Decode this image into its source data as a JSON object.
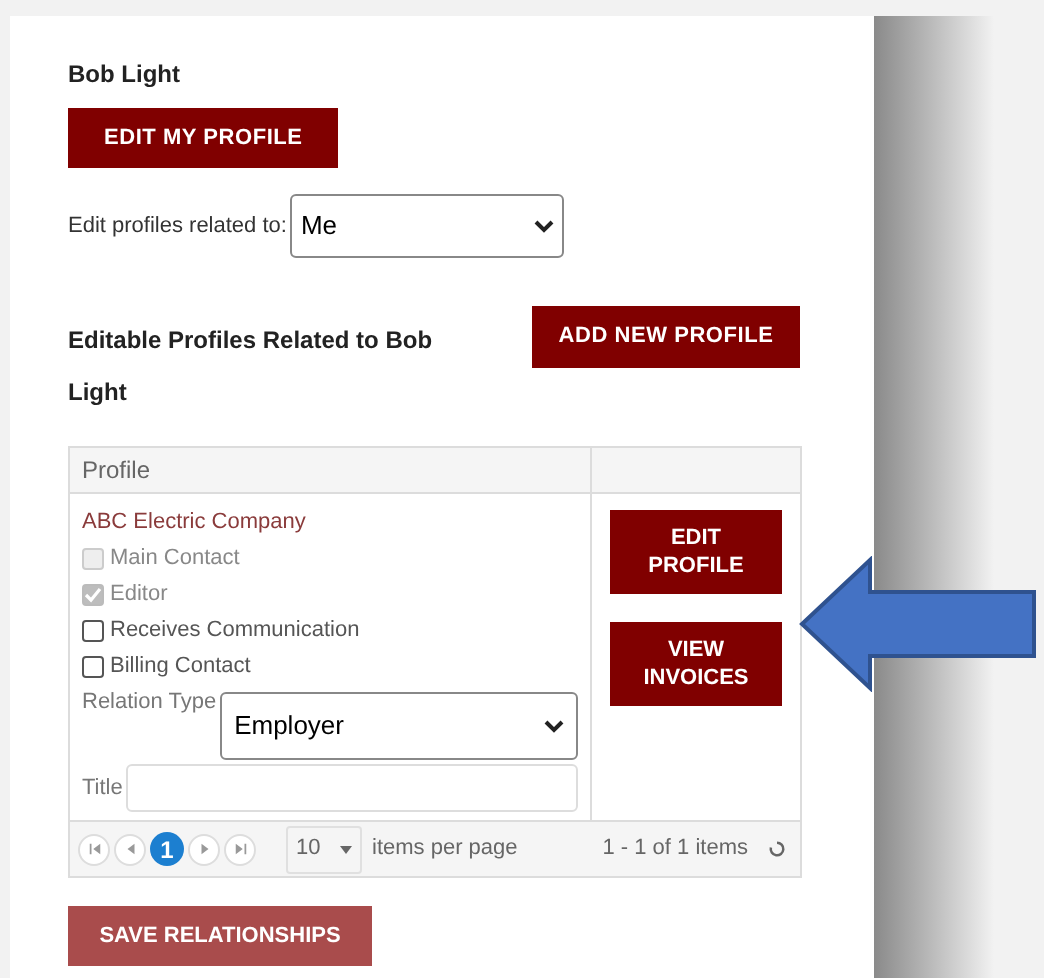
{
  "user_name": "Bob Light",
  "edit_profile_button": "EDIT MY PROFILE",
  "related_to": {
    "label": "Edit profiles related to:",
    "value": "Me"
  },
  "section_title": "Editable Profiles Related to Bob Light",
  "add_button": "ADD NEW PROFILE",
  "table": {
    "columns": [
      "Profile"
    ],
    "rows": [
      {
        "company": "ABC Electric Company",
        "options": [
          {
            "label": "Main Contact",
            "checked": false,
            "disabled": true
          },
          {
            "label": "Editor",
            "checked": true,
            "disabled": true
          },
          {
            "label": "Receives Communication",
            "checked": false,
            "disabled": false
          },
          {
            "label": "Billing Contact",
            "checked": false,
            "disabled": false
          }
        ],
        "relation_type": {
          "label": "Relation Type",
          "value": "Employer"
        },
        "title_field": {
          "label": "Title"
        },
        "actions": [
          "EDIT PROFILE",
          "VIEW INVOICES"
        ]
      }
    ]
  },
  "pager": {
    "pages": [
      {
        "label": "1",
        "selected": true
      }
    ],
    "page_size": "10",
    "page_size_label": "items per page",
    "summary": "1 - 1 of 1 items"
  },
  "save_button": {
    "label": "SAVE RELATIONSHIPS",
    "disabled": true
  }
}
